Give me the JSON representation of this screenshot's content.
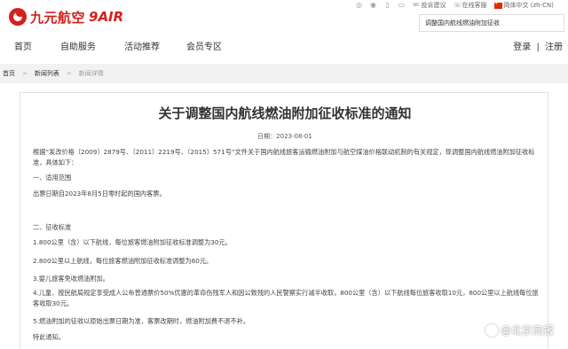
{
  "brand": {
    "name": "九元航空",
    "code": "9AIR",
    "color": "#d6201c"
  },
  "top_tools": {
    "icons": [
      "wechat-icon",
      "weibo-icon",
      "mobile-icon",
      "tablet-icon"
    ],
    "complaint_label": "投诉建议",
    "service_label": "在线客服",
    "language_label": "简体中文 (zh-CN)"
  },
  "search": {
    "value": "调整国内航线燃油附加征收"
  },
  "nav": {
    "items": [
      {
        "label": "首页"
      },
      {
        "label": "自助服务"
      },
      {
        "label": "活动推荐"
      },
      {
        "label": "会员专区"
      }
    ],
    "login_label": "登录",
    "separator": "|",
    "register_label": "注册"
  },
  "breadcrumb": {
    "separator": ">",
    "items": [
      {
        "label": "首页"
      },
      {
        "label": "新闻列表"
      },
      {
        "label": "新闻详情"
      }
    ]
  },
  "article": {
    "title": "关于调整国内航线燃油附加征收标准的通知",
    "date": "日期：2023-08-01",
    "paragraphs": [
      "根据“发改价格〔2009〕2879号、〔2011〕2219号、〔2015〕571号”文件关于国内航线旅客运输燃油附加与航空煤油价格联动机制的有关规定，现调整国内航线燃油附加征收标准，具体如下：",
      "一、适用范围",
      "出票日期自2023年8月5日零时起的国内客票。",
      "二、征收标准",
      "1.800公里（含）以下航线，每位旅客燃油附加征收标准调整为30元。",
      "2.800公里以上航线，每位旅客燃油附加征收标准调整为60元。",
      "3.婴儿旅客免收燃油附加。",
      "4.儿童、按民航局规定享受成人公布普通票价50%优惠的革命伤残军人和因公致残的人民警察实行减半收取，800公里（含）以下航线每位旅客收取10元，800公里以上航线每位旅客收取30元。",
      "5.燃油附加的征收以原始出票日期为准，客票改期时，燃油附加费不退不补。",
      "特此通知。"
    ]
  },
  "watermark": {
    "text": "@北京商报"
  }
}
